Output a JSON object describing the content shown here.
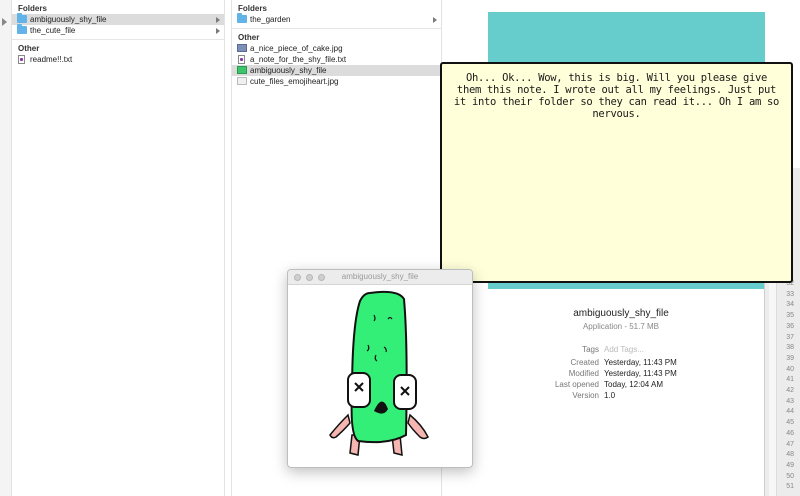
{
  "column1": {
    "folders_header": "Folders",
    "folders": [
      {
        "label": "ambiguously_shy_file",
        "selected": true
      },
      {
        "label": "the_cute_file",
        "selected": false
      }
    ],
    "other_header": "Other",
    "files": [
      {
        "label": "readme!!.txt"
      }
    ]
  },
  "column2": {
    "folders_header": "Folders",
    "folders": [
      {
        "label": "the_garden"
      }
    ],
    "other_header": "Other",
    "files": [
      {
        "label": "a_nice_piece_of_cake.jpg",
        "icon": "image-icon"
      },
      {
        "label": "a_note_for_the_shy_file.txt",
        "icon": "text-file-icon"
      },
      {
        "label": "ambiguously_shy_file",
        "icon": "app-icon",
        "selected": true
      },
      {
        "label": "cute_files_emojiheart.jpg",
        "icon": "image-icon"
      }
    ]
  },
  "info": {
    "name": "ambiguously_shy_file",
    "kind": "Application - 51.7 MB",
    "tags_label": "Tags",
    "tags_placeholder": "Add Tags...",
    "created_label": "Created",
    "created_value": "Yesterday, 11:43 PM",
    "modified_label": "Modified",
    "modified_value": "Yesterday, 11:43 PM",
    "opened_label": "Last opened",
    "opened_value": "Today, 12:04 AM",
    "version_label": "Version",
    "version_value": "1.0"
  },
  "window": {
    "title": "ambiguously_shy_file"
  },
  "bubble": {
    "text": "Oh... Ok... Wow, this is big. Will you please give them this note. I wrote out all my feelings. Just put it into their folder so they can read it... Oh I am so nervous."
  },
  "gutter": {
    "line_numbers": [
      "32",
      "33",
      "34",
      "35",
      "36",
      "37",
      "38",
      "39",
      "40",
      "41",
      "42",
      "43",
      "44",
      "45",
      "46",
      "47",
      "48",
      "49",
      "50",
      "51"
    ]
  },
  "colors": {
    "preview_bg": "#66cccc",
    "character_green": "#33ee77",
    "bubble_bg": "#ffffd9",
    "folder_blue": "#62b4e8",
    "selection": "#dcdcdc"
  }
}
